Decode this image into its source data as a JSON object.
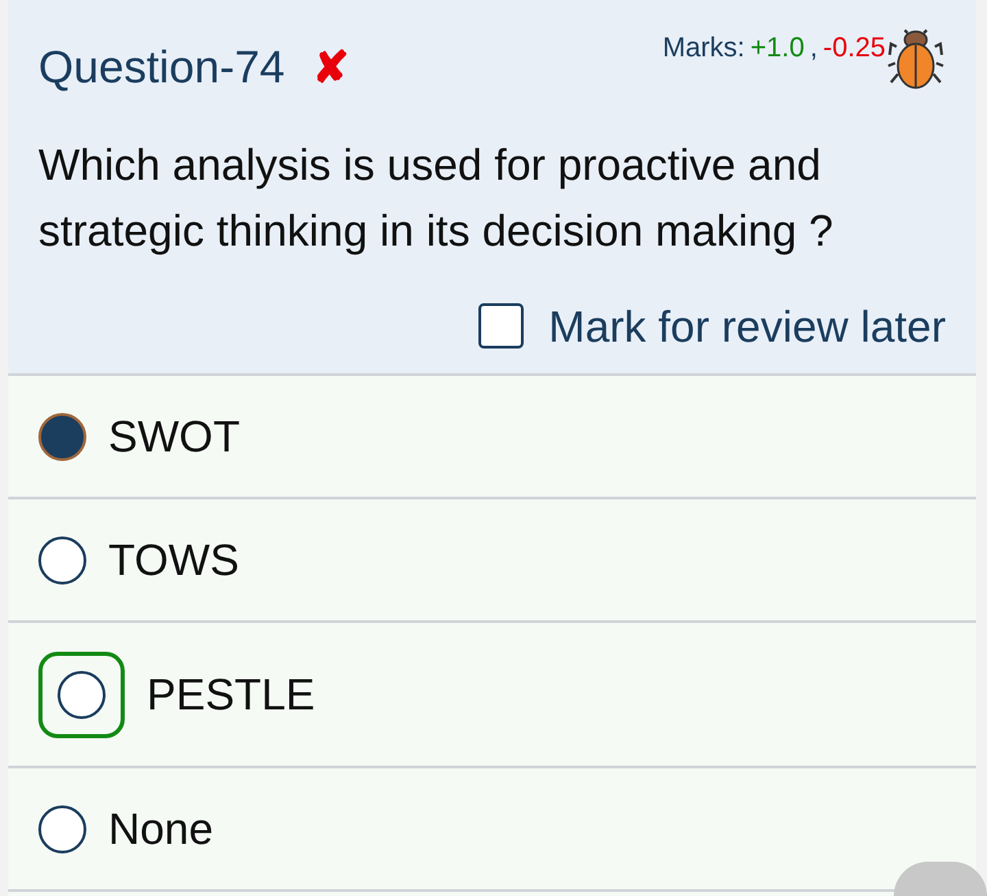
{
  "question": {
    "title": "Question-74",
    "result_mark": "✘",
    "marks_label": "Marks:",
    "positive": "+1.0",
    "separator": ",",
    "negative": "-0.25",
    "text": "Which analysis is used for proactive and strategic thinking in its decision making ?"
  },
  "review": {
    "label": "Mark for review later",
    "checked": false
  },
  "options": [
    {
      "label": "SWOT",
      "selected": true,
      "correct": false
    },
    {
      "label": "TOWS",
      "selected": false,
      "correct": false
    },
    {
      "label": "PESTLE",
      "selected": false,
      "correct": true
    },
    {
      "label": "None",
      "selected": false,
      "correct": false
    }
  ]
}
